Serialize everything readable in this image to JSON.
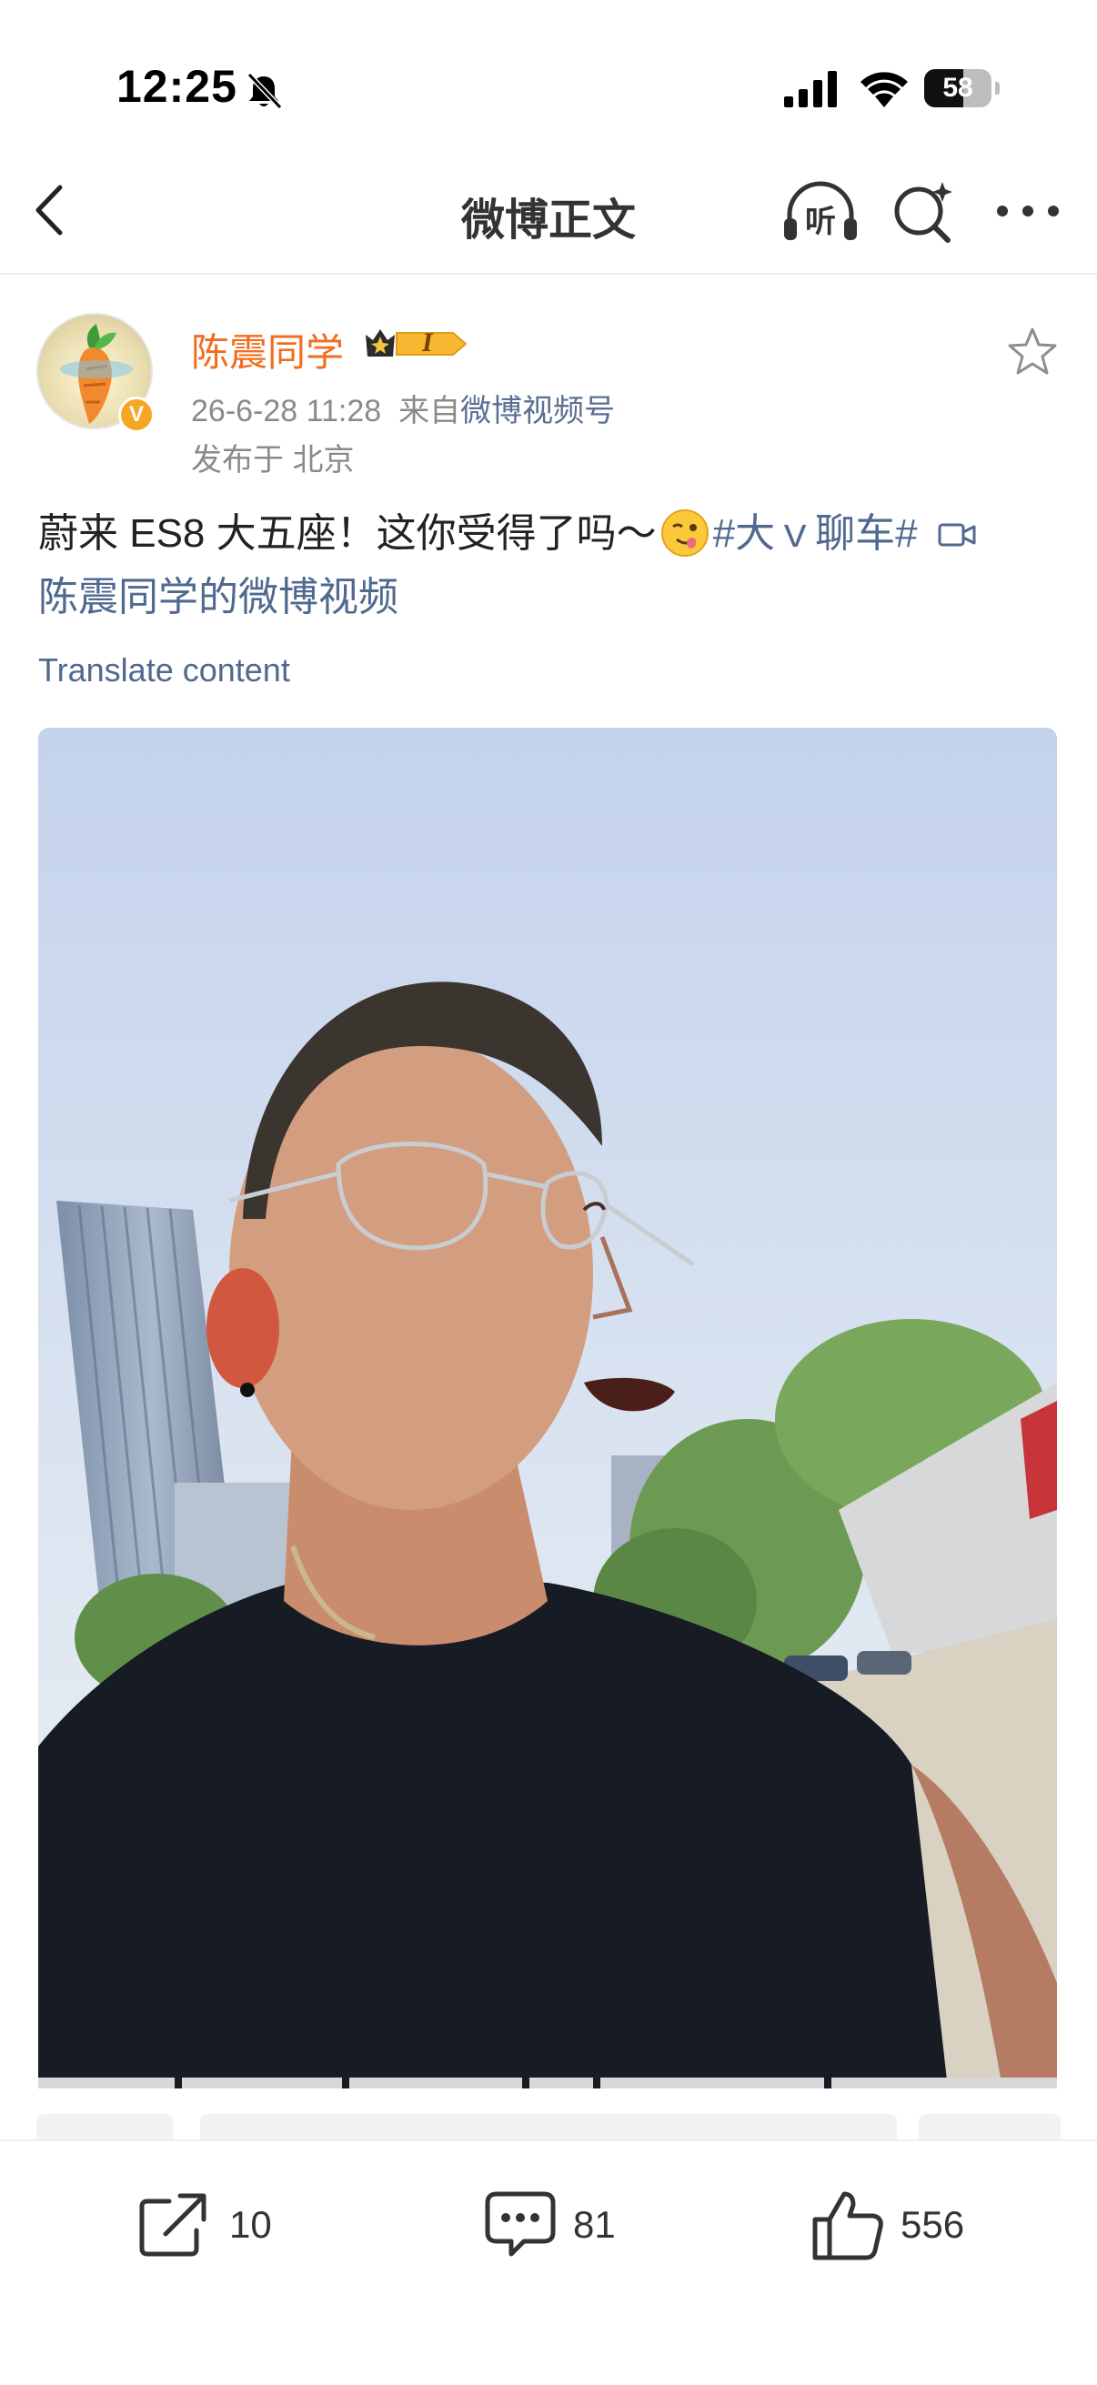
{
  "status_bar": {
    "time": "12:25",
    "battery_level": "58",
    "battery_fraction": 0.58
  },
  "nav": {
    "title": "微博正文",
    "listen_label": "听"
  },
  "author": {
    "name": "陈震同学",
    "vip_label": "I",
    "verified_mark": "V"
  },
  "post": {
    "date": "26-6-28 11:28",
    "source_prefix": "来自",
    "source": "微博视频号",
    "location": "发布于 北京",
    "text": "蔚来 ES8 大五座！这你受得了吗～",
    "topic": "#大ｖ聊车#",
    "video_link": "陈震同学的微博视频",
    "translate": "Translate content"
  },
  "actions": {
    "repost_count": "10",
    "comment_count": "81",
    "like_count": "556"
  },
  "colors": {
    "brand_orange": "#f26d1e",
    "link_blue": "#50698f",
    "meta_gray": "#8a8a8a"
  },
  "icons": [
    "bell-slash-icon",
    "signal-icon",
    "wifi-icon",
    "battery-icon",
    "back-chevron-icon",
    "headphones-icon",
    "search-sparkle-icon",
    "more-dots-icon",
    "star-icon",
    "video-camera-icon",
    "share-icon",
    "comment-icon",
    "thumbs-up-icon"
  ]
}
